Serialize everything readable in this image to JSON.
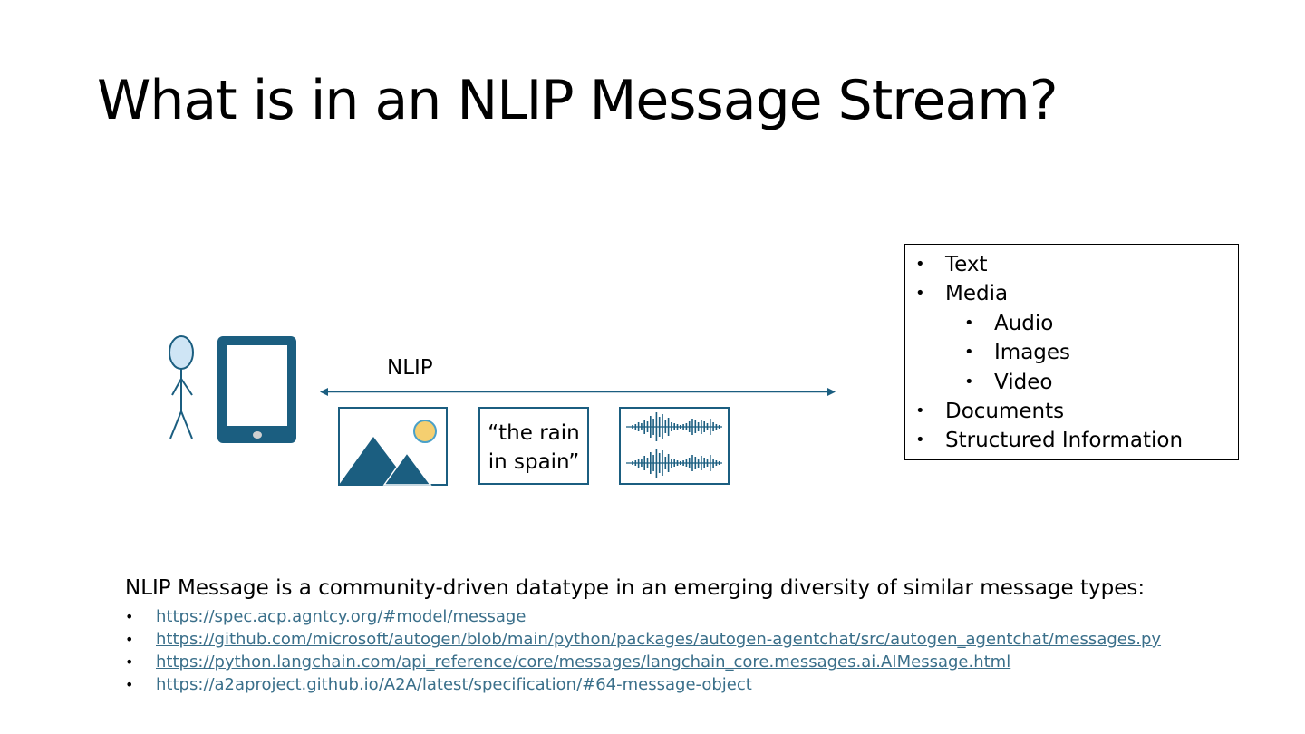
{
  "slide": {
    "title": "What is in an NLIP Message Stream?"
  },
  "diagram": {
    "arrow_label": "NLIP",
    "quote_line1": "“the rain",
    "quote_line2": "in spain”",
    "icons": [
      "person-icon",
      "tablet-icon",
      "image-icon",
      "text-quote-box",
      "audio-waveform-icon"
    ],
    "colors": {
      "accent": "#1b5e80",
      "sun": "#f5cf70",
      "head": "#cfe5f5"
    }
  },
  "content_types": {
    "items": [
      {
        "label": "Text",
        "level": 1
      },
      {
        "label": "Media",
        "level": 1
      },
      {
        "label": "Audio",
        "level": 2
      },
      {
        "label": "Images",
        "level": 2
      },
      {
        "label": "Video",
        "level": 2
      },
      {
        "label": "Documents",
        "level": 1
      },
      {
        "label": "Structured Information",
        "level": 1
      }
    ]
  },
  "footer": {
    "description": "NLIP Message is a community-driven datatype in an emerging diversity of similar message types:",
    "links": [
      "https://spec.acp.agntcy.org/#model/message",
      "https://github.com/microsoft/autogen/blob/main/python/packages/autogen-agentchat/src/autogen_agentchat/messages.py",
      "https://python.langchain.com/api_reference/core/messages/langchain_core.messages.ai.AIMessage.html",
      "https://a2aproject.github.io/A2A/latest/specification/#64-message-object"
    ]
  }
}
